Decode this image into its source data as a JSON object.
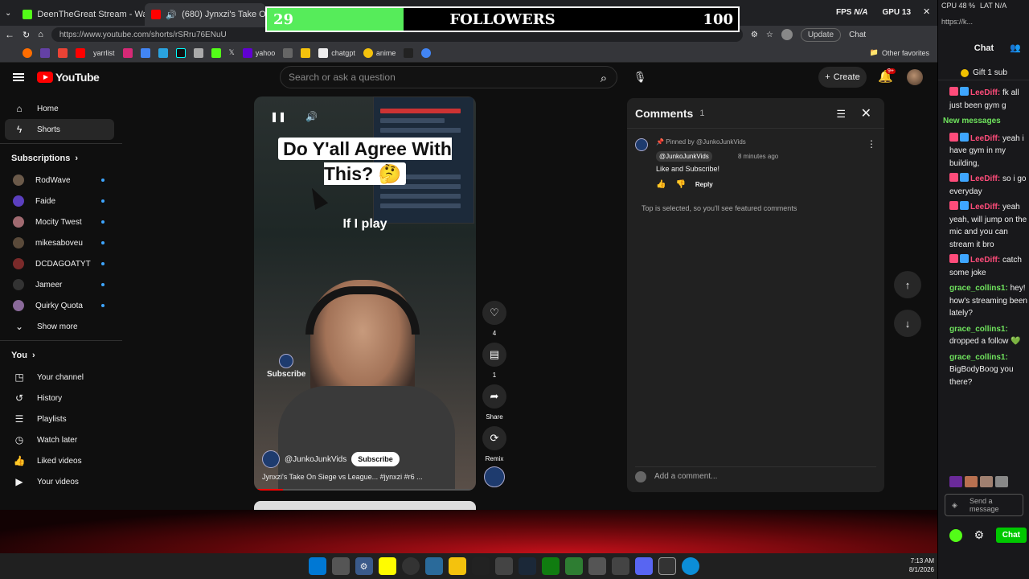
{
  "browser": {
    "tabs": [
      {
        "label": "DeenTheGreat Stream - Watc"
      },
      {
        "label": "(680) Jynxzi's Take On Siege v"
      }
    ],
    "url": "https://www.youtube.com/shorts/rSRru76ENuU",
    "update_label": "Update",
    "chat_label": "Chat",
    "bookmarks": [
      "yarrlist",
      "yahoo",
      "chatgpt",
      "anime"
    ],
    "other_favorites": "Other favorites"
  },
  "overlay": {
    "followers_current": "29",
    "followers_title": "FOLLOWERS",
    "followers_goal": "100",
    "progress_fraction": 0.29,
    "fps_label": "FPS",
    "fps_value": "N/A",
    "gpu_label": "GPU",
    "gpu_value": "13",
    "cpu_label": "CPU",
    "cpu_value": "48 %",
    "lat_label": "LAT",
    "lat_value": "N/A"
  },
  "youtube": {
    "logo": "YouTube",
    "search_placeholder": "Search or ask a question",
    "create_label": "Create",
    "notif_badge": "9+",
    "sidebar": {
      "home": "Home",
      "shorts": "Shorts",
      "subscriptions": "Subscriptions",
      "subs": [
        {
          "name": "RodWave",
          "color": "#6b5a4a"
        },
        {
          "name": "Faide",
          "color": "#5b3fbf"
        },
        {
          "name": "Mocity Twest",
          "color": "#a06a70"
        },
        {
          "name": "mikesaboveu",
          "color": "#5a4a3a"
        },
        {
          "name": "DCDAGOATYT",
          "color": "#7a2a2a"
        },
        {
          "name": "Jameer",
          "color": "#333333"
        },
        {
          "name": "Quirky Quota",
          "color": "#8a6a9a"
        }
      ],
      "show_more": "Show more",
      "you": "You",
      "you_items": [
        "Your channel",
        "History",
        "Playlists",
        "Watch later",
        "Liked videos",
        "Your videos"
      ]
    },
    "video": {
      "caption_big": "Do Y'all Agree With This? 🤔",
      "caption_sub": "If I play",
      "subscribe_overlay": "Subscribe",
      "channel": "@JunkoJunkVids",
      "subscribe_label": "Subscribe",
      "title": "Jynxzi's Take On Siege vs League... #jynxzi #r6 ...",
      "progress_fraction": 0.13
    },
    "actions": {
      "likes": "4",
      "comments": "1",
      "share": "Share",
      "remix": "Remix"
    },
    "comments": {
      "title": "Comments",
      "count": "1",
      "pinned": "Pinned by @JunkoJunkVids",
      "author": "@JunkoJunkVids",
      "time": "8 minutes ago",
      "text": "Like and Subscribe!",
      "reply": "Reply",
      "note": "Top is selected, so you'll see featured comments",
      "add_placeholder": "Add a comment..."
    }
  },
  "twitch": {
    "top_url": "https://k...",
    "header": "Chat",
    "gift": "Gift 1 sub",
    "new_messages": "New messages",
    "messages": [
      {
        "user": "LeeDiff",
        "text": "fk all just been gym g",
        "kind": "u1"
      },
      {
        "user": "LeeDiff",
        "text": "yeah i have gym in my building,",
        "kind": "u1"
      },
      {
        "user": "LeeDiff",
        "text": "so i go everyday",
        "kind": "u1"
      },
      {
        "user": "LeeDiff",
        "text": "yeah yeah, will jump on the mic and you can stream it bro",
        "kind": "u1"
      },
      {
        "user": "LeeDiff",
        "text": "catch some joke",
        "kind": "u1"
      },
      {
        "user": "grace_collins1",
        "text": "hey! how's streaming been lately?",
        "kind": "u2"
      },
      {
        "user": "grace_collins1",
        "text": "dropped a follow 💚",
        "kind": "u2"
      },
      {
        "user": "grace_collins1",
        "text": "BigBodyBoog you there?",
        "kind": "u2"
      }
    ],
    "send_placeholder": "Send a message",
    "chat_button": "Chat"
  },
  "taskbar": {
    "time": "7:13 AM",
    "date": "8/1/2026"
  },
  "colors": {
    "yt_red": "#ff0000",
    "twitch_green": "#00c800",
    "follower_bar": "#56ec5a"
  }
}
